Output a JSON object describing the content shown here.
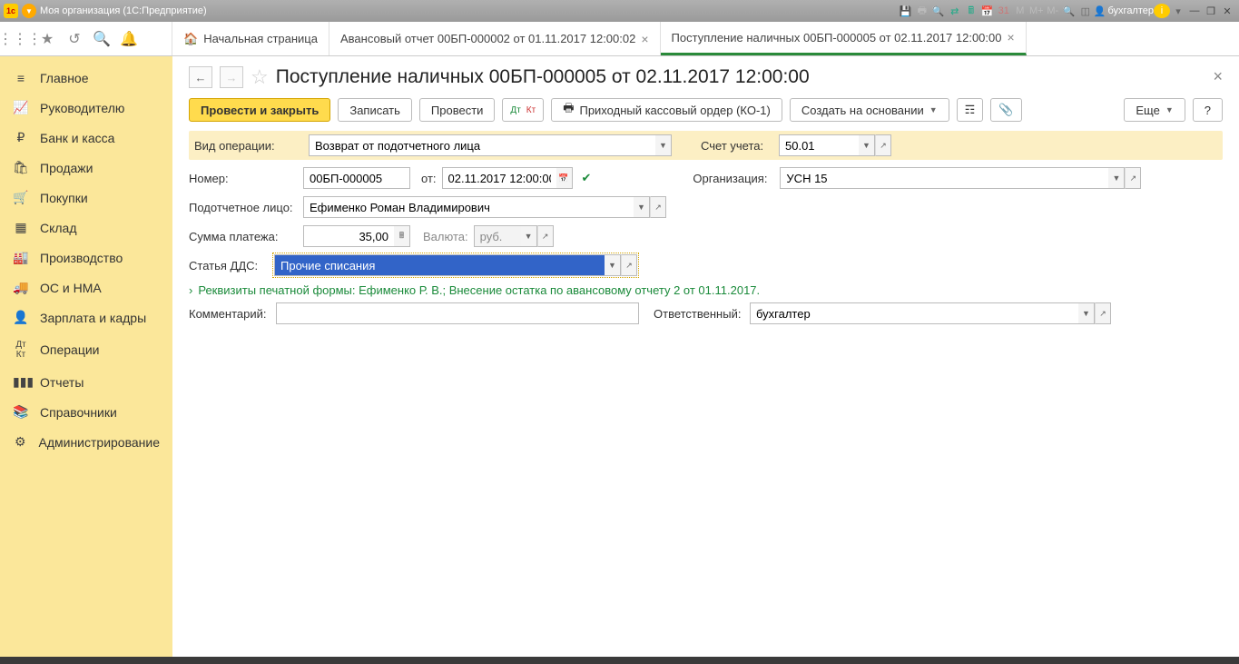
{
  "titlebar": {
    "app_title": "Моя организация  (1С:Предприятие)",
    "user": "бухгалтер"
  },
  "tabs": {
    "home": "Начальная страница",
    "t1": "Авансовый отчет 00БП-000002 от 01.11.2017 12:00:02",
    "t2": "Поступление наличных 00БП-000005 от 02.11.2017 12:00:00"
  },
  "sidebar": {
    "items": [
      "Главное",
      "Руководителю",
      "Банк и касса",
      "Продажи",
      "Покупки",
      "Склад",
      "Производство",
      "ОС и НМА",
      "Зарплата и кадры",
      "Операции",
      "Отчеты",
      "Справочники",
      "Администрирование"
    ]
  },
  "page": {
    "title": "Поступление наличных 00БП-000005 от 02.11.2017 12:00:00",
    "actions": {
      "post_close": "Провести и закрыть",
      "save": "Записать",
      "post": "Провести",
      "print": "Приходный кассовый ордер (КО-1)",
      "create_based": "Создать на основании",
      "more": "Еще",
      "help": "?"
    },
    "fields": {
      "op_type_lbl": "Вид операции:",
      "op_type": "Возврат от подотчетного лица",
      "account_lbl": "Счет учета:",
      "account": "50.01",
      "number_lbl": "Номер:",
      "number": "00БП-000005",
      "date_lbl": "от:",
      "date": "02.11.2017 12:00:00",
      "org_lbl": "Организация:",
      "org": "УСН 15",
      "person_lbl": "Подотчетное лицо:",
      "person": "Ефименко Роман Владимирович",
      "sum_lbl": "Сумма платежа:",
      "sum": "35,00",
      "currency_lbl": "Валюта:",
      "currency": "руб.",
      "dds_lbl": "Статья ДДС:",
      "dds": "Прочие списания",
      "print_details": "Реквизиты печатной формы: Ефименко Р. В.; Внесение остатка по авансовому отчету 2 от 01.11.2017.",
      "comment_lbl": "Комментарий:",
      "responsible_lbl": "Ответственный:",
      "responsible": "бухгалтер"
    }
  }
}
